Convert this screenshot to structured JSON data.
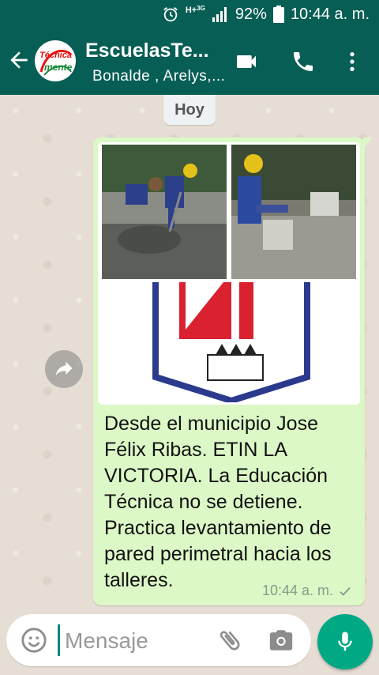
{
  "status_bar": {
    "network": "H+",
    "network_sub": "3G",
    "battery": "92%",
    "time": "10:44 a. m."
  },
  "header": {
    "title": "EscuelasTe...",
    "subtitle": "Bonalde , Arelys,...",
    "avatar_line1": "Técnica",
    "avatar_line2": "mente"
  },
  "chat": {
    "date_label": "Hoy",
    "message": {
      "text": "Desde el municipio Jose Félix Ribas. ETIN LA VICTORIA. La Educación Técnica no se detiene. Practica  levantamiento de pared perimetral hacia los talleres.",
      "time": "10:44 a. m.",
      "status_icon": "single-check-icon"
    }
  },
  "input": {
    "placeholder": "Mensaje"
  },
  "colors": {
    "header": "#075e54",
    "bubble": "#dcf8c6",
    "accent": "#00a884"
  }
}
